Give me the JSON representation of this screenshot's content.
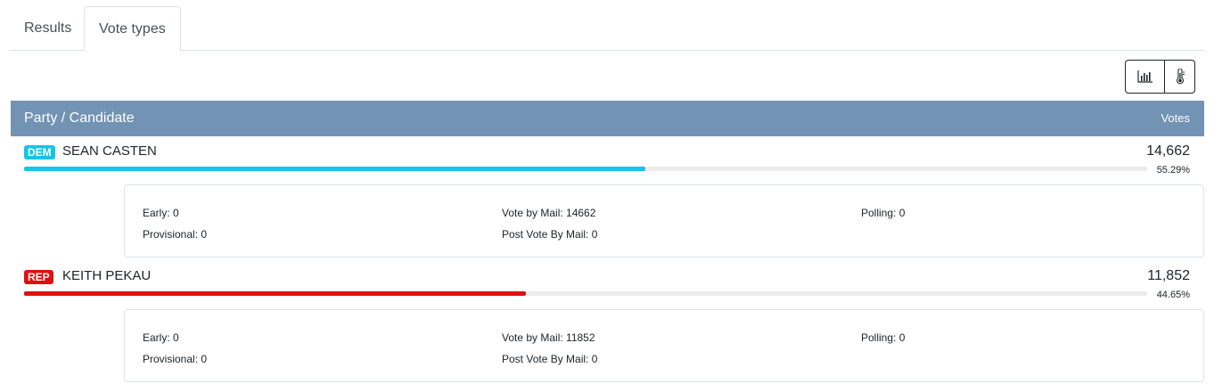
{
  "tabs": [
    {
      "label": "Results",
      "active": false
    },
    {
      "label": "Vote types",
      "active": true
    }
  ],
  "toolbar": {
    "buttons": [
      {
        "icon": "bar-chart-icon"
      },
      {
        "icon": "thermometer-icon"
      }
    ]
  },
  "table": {
    "header_left": "Party / Candidate",
    "header_right": "Votes"
  },
  "candidates": [
    {
      "party": "DEM",
      "party_color": "#17c4e8",
      "name": "SEAN CASTEN",
      "votes": "14,662",
      "percent": "55.29%",
      "share": 0.5529,
      "bar_color": "#17c4e8",
      "details": {
        "early": "Early: 0",
        "vote_by_mail": "Vote by Mail: 14662",
        "polling": "Polling: 0",
        "provisional": "Provisional: 0",
        "post_vote_by_mail": "Post Vote By Mail: 0"
      }
    },
    {
      "party": "REP",
      "party_color": "#e01010",
      "name": "KEITH PEKAU",
      "votes": "11,852",
      "percent": "44.65%",
      "share": 0.4465,
      "bar_color": "#e01010",
      "details": {
        "early": "Early: 0",
        "vote_by_mail": "Vote by Mail: 11852",
        "polling": "Polling: 0",
        "provisional": "Provisional: 0",
        "post_vote_by_mail": "Post Vote By Mail: 0"
      }
    }
  ]
}
